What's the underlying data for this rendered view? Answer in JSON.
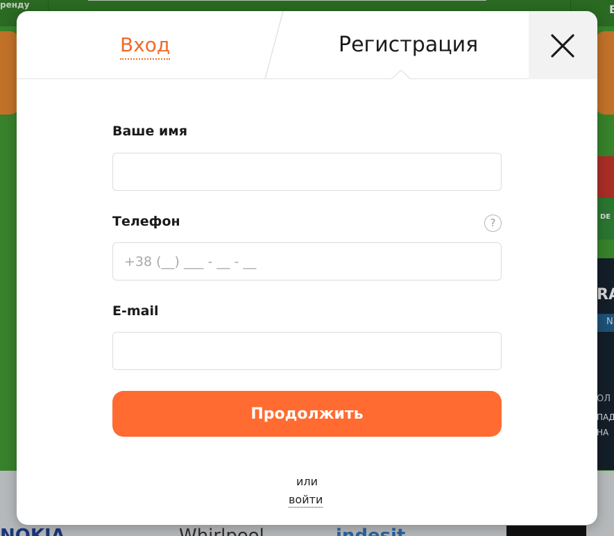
{
  "background": {
    "topbar_left_text": "ренду",
    "topbar_right_text": "В",
    "right_badge": "DE",
    "right_dark_title": "RA",
    "right_dark_band": "N",
    "right_dark_line1": "ОЛ",
    "right_dark_line2": "ПАД",
    "right_dark_line3": "НА",
    "brands": [
      "NOKIA",
      "Whirlpool",
      "indesit"
    ]
  },
  "modal": {
    "tabs": {
      "login_label": "Вход",
      "register_label": "Регистрация"
    },
    "close_icon": "close-icon",
    "form": {
      "name_label": "Ваше имя",
      "name_value": "",
      "phone_label": "Телефон",
      "phone_placeholder": "+38 (__) ___ - __ - __",
      "help_glyph": "?",
      "email_label": "E-mail",
      "email_value": "",
      "submit_label": "Продолжить",
      "or_text": "или",
      "login_link": "войти"
    }
  },
  "colors": {
    "accent": "#ff6b30",
    "tab_active_text": "#f06a2a",
    "background_green": "#3f9a2f"
  }
}
